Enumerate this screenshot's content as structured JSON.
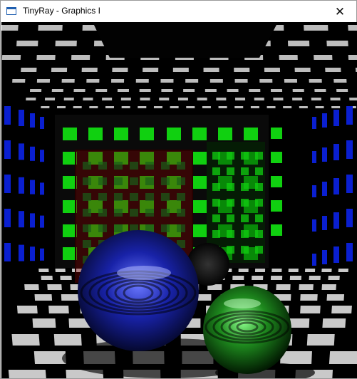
{
  "window": {
    "title": "TinyRay - Graphics I",
    "close_glyph": "✕",
    "app_icon": "window-icon"
  },
  "scene": {
    "description_icon": "raytraced-render",
    "colors": {
      "floor_tile": "#c9c9c9",
      "ceiling_tile": "#bdbdbd",
      "left_wall_tile": "#0a1fd0",
      "right_wall_tile": "#10d010",
      "back_wall_tile": "#10d010",
      "glass_block_tint": "#8a0000",
      "sphere_blue": "#1822a8",
      "sphere_green": "#1e8a1e"
    }
  }
}
